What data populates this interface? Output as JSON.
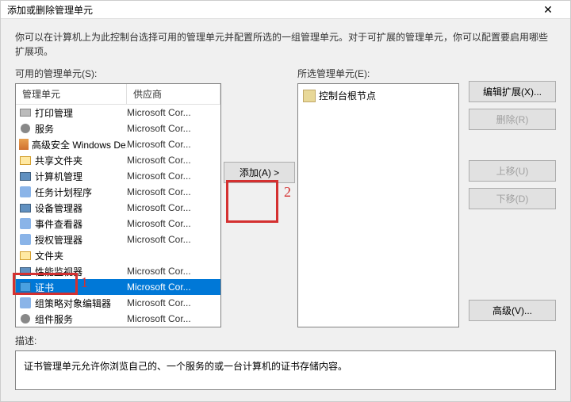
{
  "window": {
    "title": "添加或删除管理单元"
  },
  "intro": "你可以在计算机上为此控制台选择可用的管理单元并配置所选的一组管理单元。对于可扩展的管理单元，你可以配置要启用哪些扩展项。",
  "available": {
    "label": "可用的管理单元(S):",
    "headers": {
      "snapin": "管理单元",
      "vendor": "供应商"
    },
    "items": [
      {
        "name": "打印管理",
        "vendor": "Microsoft Cor...",
        "icon": "printer"
      },
      {
        "name": "服务",
        "vendor": "Microsoft Cor...",
        "icon": "gear"
      },
      {
        "name": "高级安全 Windows De...",
        "vendor": "Microsoft Cor...",
        "icon": "shield"
      },
      {
        "name": "共享文件夹",
        "vendor": "Microsoft Cor...",
        "icon": "folder"
      },
      {
        "name": "计算机管理",
        "vendor": "Microsoft Cor...",
        "icon": "mon"
      },
      {
        "name": "任务计划程序",
        "vendor": "Microsoft Cor...",
        "icon": "svc"
      },
      {
        "name": "设备管理器",
        "vendor": "Microsoft Cor...",
        "icon": "mon"
      },
      {
        "name": "事件查看器",
        "vendor": "Microsoft Cor...",
        "icon": "svc"
      },
      {
        "name": "授权管理器",
        "vendor": "Microsoft Cor...",
        "icon": "svc"
      },
      {
        "name": "文件夹",
        "vendor": "",
        "icon": "folder"
      },
      {
        "name": "性能监视器",
        "vendor": "Microsoft Cor...",
        "icon": "mon"
      },
      {
        "name": "证书",
        "vendor": "Microsoft Cor...",
        "icon": "cert",
        "selected": true
      },
      {
        "name": "组策略对象编辑器",
        "vendor": "Microsoft Cor...",
        "icon": "svc"
      },
      {
        "name": "组件服务",
        "vendor": "Microsoft Cor...",
        "icon": "gear"
      }
    ]
  },
  "add_button": "添加(A) >",
  "selected": {
    "label": "所选管理单元(E):",
    "root": "控制台根节点"
  },
  "buttons": {
    "edit_ext": "编辑扩展(X)...",
    "remove": "删除(R)",
    "up": "上移(U)",
    "down": "下移(D)",
    "advanced": "高级(V)..."
  },
  "description": {
    "label": "描述:",
    "text": "证书管理单元允许你浏览自己的、一个服务的或一台计算机的证书存储内容。"
  },
  "annotations": {
    "one": "1",
    "two": "2"
  }
}
